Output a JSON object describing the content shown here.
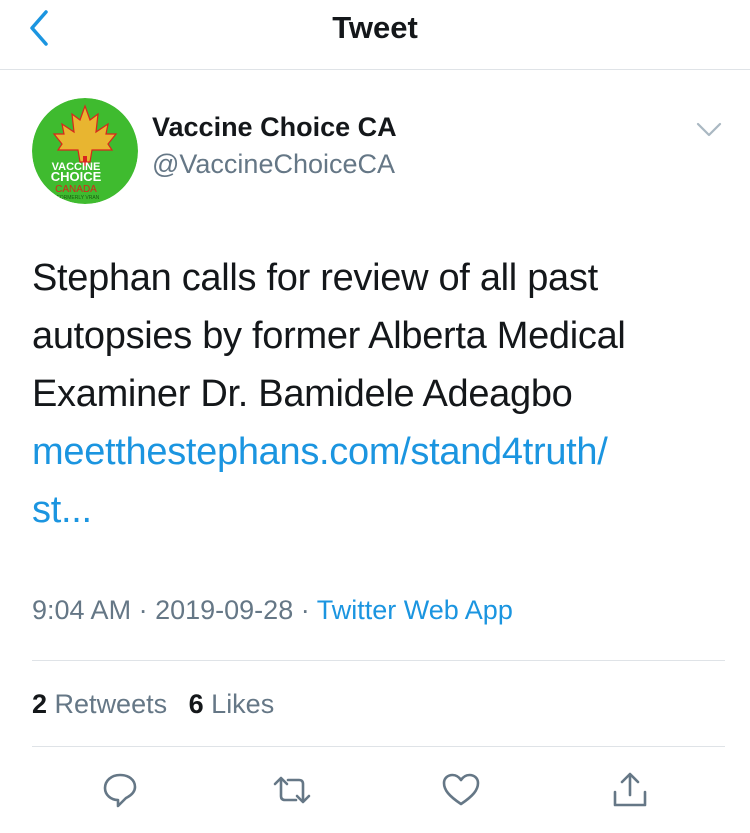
{
  "header": {
    "title": "Tweet"
  },
  "tweet": {
    "display_name": "Vaccine Choice CA",
    "handle": "@VaccineChoiceCA",
    "avatar": {
      "line1": "VACCINE",
      "line2": "CHOICE",
      "line3": "CANADA",
      "line4": "FORMERLY VRAN",
      "colors": {
        "bg": "#3fbb2f",
        "leaf": "#e8b530",
        "red": "#d9251d"
      }
    },
    "text_lines": [
      "Stephan calls for review of all past",
      "autopsies by former Alberta Medical",
      "Examiner Dr. Bamidele Adeagbo"
    ],
    "link_lines": [
      "meetthestephans.com/stand4truth/",
      "st..."
    ],
    "time": "9:04 AM",
    "date": "2019-09-28",
    "separator": "·",
    "source": "Twitter Web App",
    "retweets_count": "2",
    "retweets_label": "Retweets",
    "likes_count": "6",
    "likes_label": "Likes"
  },
  "icons": [
    "back-chevron-icon",
    "caret-down-icon",
    "reply-icon",
    "retweet-icon",
    "like-icon",
    "share-icon"
  ],
  "colors": {
    "accent": "#1b95e0",
    "muted": "#657786",
    "text": "#14171a",
    "divider": "#dfe3e7"
  }
}
